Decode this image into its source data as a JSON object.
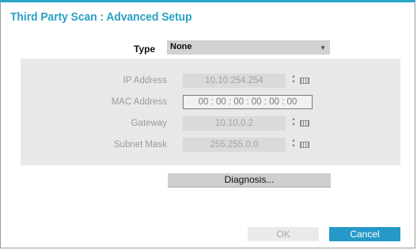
{
  "dialog": {
    "title": "Third Party Scan : Advanced Setup"
  },
  "type": {
    "label": "Type",
    "value": "None"
  },
  "fields": {
    "ip_address": {
      "label": "IP Address",
      "value": "10.10.254.254"
    },
    "mac_address": {
      "label": "MAC Address",
      "value": "00 : 00 : 00 : 00 : 00 : 00"
    },
    "gateway": {
      "label": "Gateway",
      "value": "10.10.0.2"
    },
    "subnet_mask": {
      "label": "Subnet Mask",
      "value": "255.255.0.0"
    }
  },
  "buttons": {
    "diagnosis": "Diagnosis...",
    "ok": "OK",
    "cancel": "Cancel"
  },
  "colors": {
    "accent": "#2aa7c9",
    "cancel_bg": "#2599c8",
    "panel_bg": "#e8e8e8"
  },
  "icons": {
    "spinner": "up-down-spinner-icon",
    "keyboard": "keyboard-icon",
    "dropdown": "chevron-down-icon"
  }
}
